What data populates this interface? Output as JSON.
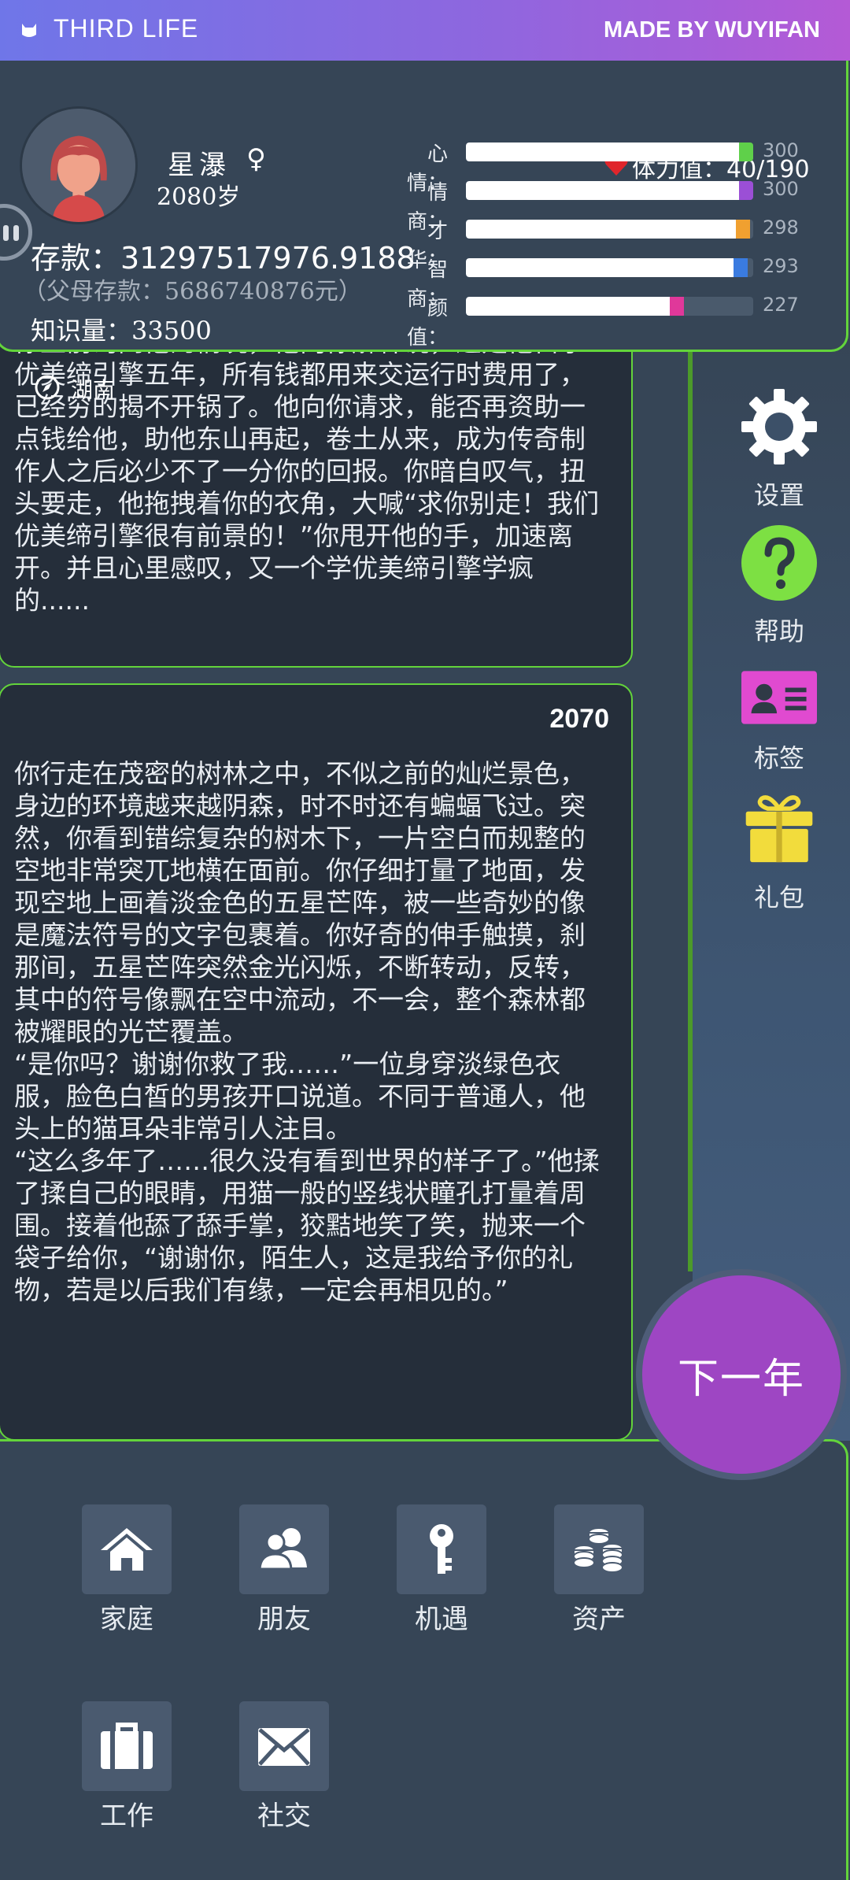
{
  "header": {
    "app_title": "THIRD LIFE",
    "credit": "MADE BY WUYIFAN"
  },
  "profile": {
    "name": "星瀑",
    "gender_icon": "♀",
    "age": "2080岁",
    "stamina": "体力值：40/190",
    "deposit": "存款：31297517976.9188",
    "parent_deposit": "（父母存款：5686740876元）",
    "knowledge": "知识量：33500",
    "location": "湖南"
  },
  "attributes": [
    {
      "label": "心情：",
      "value": "300",
      "fill": 1.0,
      "color": "#5fd04a"
    },
    {
      "label": "情商：",
      "value": "300",
      "fill": 1.0,
      "color": "#9b4fd6"
    },
    {
      "label": "才华：",
      "value": "298",
      "fill": 0.99,
      "color": "#f0a030"
    },
    {
      "label": "智商：",
      "value": "293",
      "fill": 0.98,
      "color": "#3a7be0"
    },
    {
      "label": "颜值：",
      "value": "227",
      "fill": 0.76,
      "color": "#e0389a"
    }
  ],
  "events": [
    {
      "year": "",
      "text": "你上前询问他的情况，他向你解释说，这是他自学优美缔引擎五年，所有钱都用来交运行时费用了，已经穷的揭不开锅了。他向你请求，能否再资助一点钱给他，助他东山再起，卷土从来，成为传奇制作人之后必少不了一分你的回报。你暗自叹气，扭头要走，他拖拽着你的衣角，大喊“求你别走！我们优美缔引擎很有前景的！”你甩开他的手，加速离开。并且心里感叹，又一个学优美缔引擎学疯的......"
    },
    {
      "year": "2070",
      "text": "你行走在茂密的树林之中，不似之前的灿烂景色，身边的环境越来越阴森，时不时还有蝙蝠飞过。突然，你看到错综复杂的树木下，一片空白而规整的空地非常突兀地横在面前。你仔细打量了地面，发现空地上画着淡金色的五星芒阵，被一些奇妙的像是魔法符号的文字包裹着。你好奇的伸手触摸，刹那间，五星芒阵突然金光闪烁，不断转动，反转，其中的符号像飘在空中流动，不一会，整个森林都被耀眼的光芒覆盖。\n“是你吗？谢谢你救了我……”一位身穿淡绿色衣服，脸色白皙的男孩开口说道。不同于普通人，他头上的猫耳朵非常引人注目。\n“这么多年了……很久没有看到世界的样子了。”他揉了揉自己的眼睛，用猫一般的竖线状瞳孔打量着周围。接着他舔了舔手掌，狡黠地笑了笑，抛来一个袋子给你，“谢谢你，陌生人，这是我给予你的礼物，若是以后我们有缘，一定会再相见的。”"
    }
  ],
  "side_menu": {
    "settings": "设置",
    "help": "帮助",
    "tags": "标签",
    "gift": "礼包"
  },
  "next_year": "下一年",
  "bottom_menu": {
    "family": "家庭",
    "friends": "朋友",
    "opportunity": "机遇",
    "assets": "资产",
    "work": "工作",
    "social": "社交"
  }
}
